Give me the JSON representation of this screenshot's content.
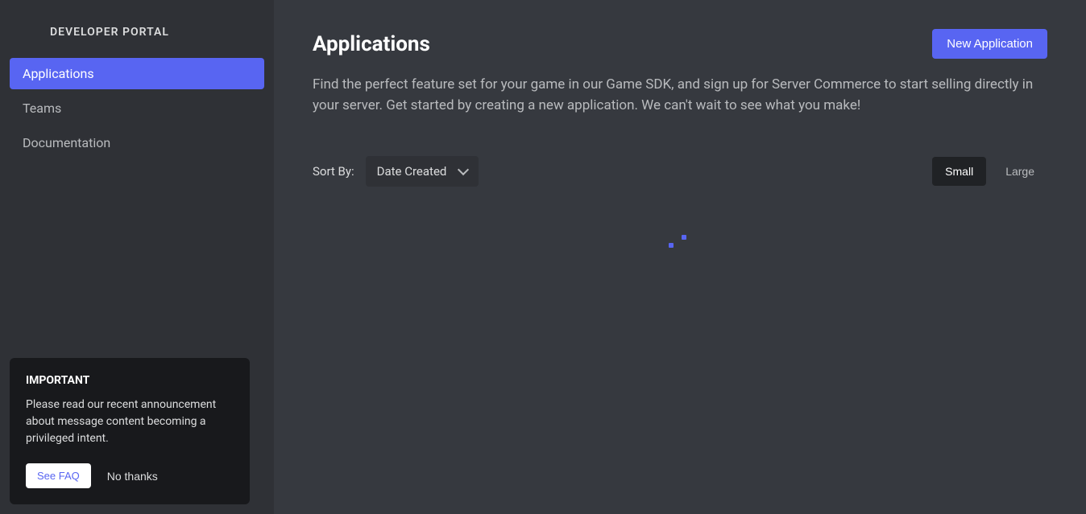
{
  "sidebar": {
    "title": "DEVELOPER PORTAL",
    "nav": [
      {
        "label": "Applications",
        "active": true
      },
      {
        "label": "Teams",
        "active": false
      },
      {
        "label": "Documentation",
        "active": false
      }
    ],
    "notice": {
      "title": "IMPORTANT",
      "body": "Please read our recent announcement about message content becoming a privileged intent.",
      "faq_label": "See FAQ",
      "dismiss_label": "No thanks"
    }
  },
  "main": {
    "title": "Applications",
    "new_button": "New Application",
    "description": "Find the perfect feature set for your game in our Game SDK, and sign up for Server Commerce to start selling directly in your server. Get started by creating a new application. We can't wait to see what you make!",
    "sort_label": "Sort By:",
    "sort_value": "Date Created",
    "view": {
      "small": "Small",
      "large": "Large",
      "active": "small"
    }
  }
}
